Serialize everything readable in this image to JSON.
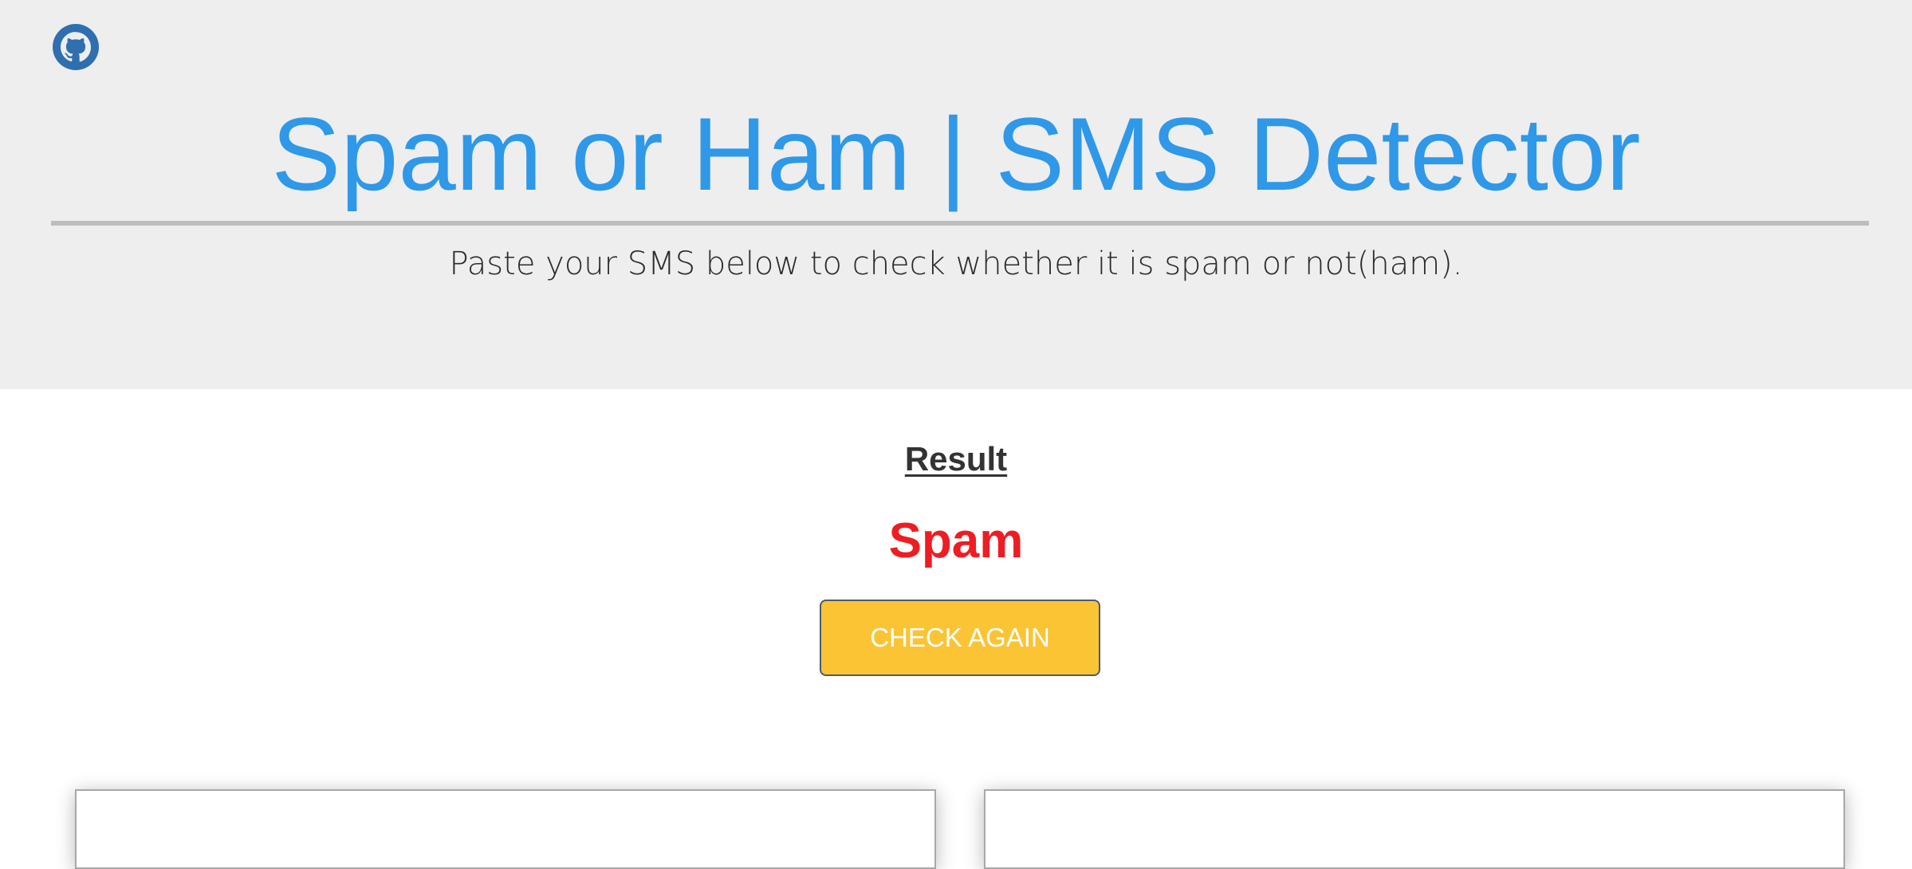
{
  "header": {
    "github_icon": "github-icon",
    "title": "Spam or Ham | SMS Detector",
    "subtitle": "Paste your SMS below to check whether it is spam or not(ham)."
  },
  "result": {
    "heading": "Result",
    "value": "Spam",
    "value_color": "#ee1d23"
  },
  "actions": {
    "check_again_label": "CHECK AGAIN"
  },
  "colors": {
    "title": "#2f98e8",
    "header_background": "#eeeeee",
    "button_background": "#fbc434",
    "github_icon": "#2f6fb0"
  }
}
